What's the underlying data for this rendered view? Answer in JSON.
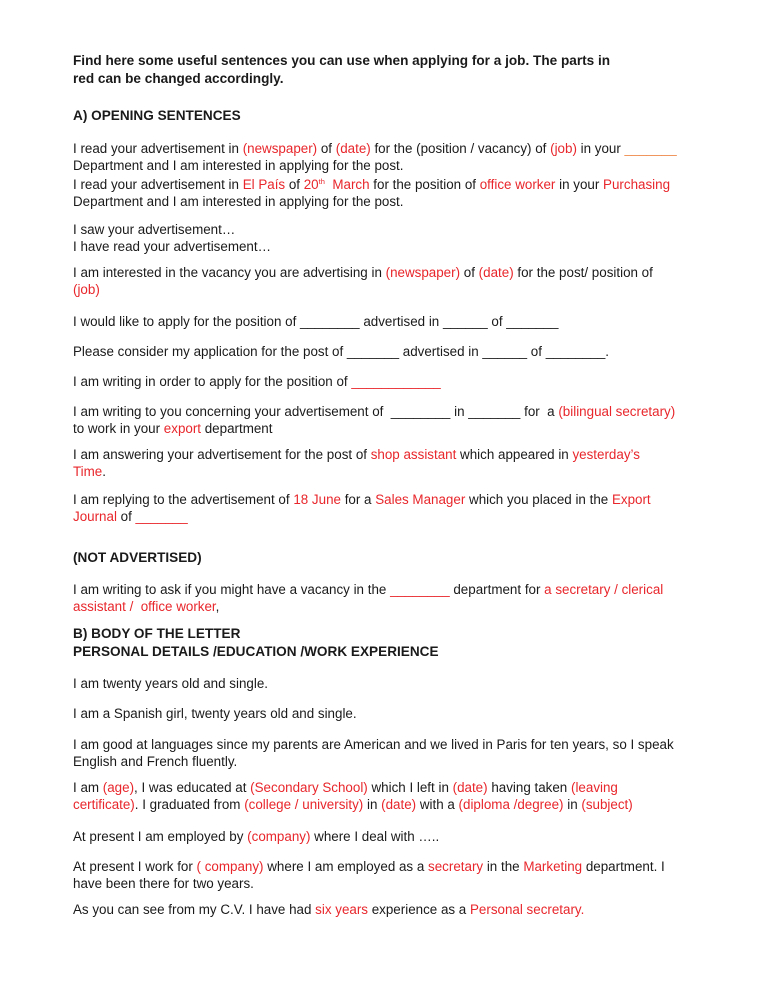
{
  "colors": {
    "text": "#1a1a1a",
    "editable": "#e8262b",
    "blank_orange": "#ef8a4c"
  },
  "intro": {
    "line1": "Find here some useful sentences you can use when applying for a job. The parts in",
    "line2": "red can be changed accordingly."
  },
  "section_a": {
    "heading": "A) OPENING SENTENCES",
    "p1": {
      "a": "I read your advertisement in ",
      "b": "(newspaper)",
      "c": " of ",
      "d": "(date)",
      "e": " for the (position / vacancy) of ",
      "f": "(job)",
      "g": " in your ",
      "h": "_______",
      "line2": "Department and I am interested in applying for the post."
    },
    "p2": {
      "a": "I read your advertisement in ",
      "b": "El País",
      "c": " of ",
      "d": "20",
      "d_sup": "th",
      "e": "  March",
      "f": " for the position of ",
      "g": "office worker",
      "h": " in your ",
      "i": "Purchasing",
      "line2": "Department and I am interested in applying for the post."
    },
    "p3": {
      "line1": "I saw your advertisement…",
      "line2": "I have read your advertisement…"
    },
    "p4": {
      "a": "I am interested in the vacancy you are advertising in ",
      "b": "(newspaper)",
      "c": " of ",
      "d": "(date)",
      "e": " for the post/ position of",
      "line2": "(job)"
    },
    "p5": "I would like to apply for the position of ________ advertised in ______ of _______",
    "p6": "Please consider my application for the post of _______ advertised in ______ of ________.",
    "p7": {
      "a": "I am writing in order to apply for the position of ",
      "b": "____________"
    },
    "p8": {
      "a": "I am writing to you concerning your advertisement of  ________ in _______ for  a ",
      "b": "(bilingual secretary)",
      "line2a": "to work in your ",
      "line2b": "export",
      "line2c": " department"
    },
    "p9": {
      "a": "I am answering your advertisement for the post of ",
      "b": "shop assistant",
      "c": " which appeared in ",
      "d": "yesterday’s",
      "line2a": "Time",
      "line2b": "."
    },
    "p10": {
      "a": "I am replying to the advertisement of ",
      "b": "18 June",
      "c": " for a ",
      "d": "Sales Manager",
      "e": " which you placed in the ",
      "f": "Export",
      "line2a": "Journal",
      "line2b": " of ",
      "line2c": "_______"
    }
  },
  "not_advertised": {
    "heading": "(NOT ADVERTISED)",
    "p1": {
      "a": "I am writing to ask if you might have a vacancy in the ",
      "b": "________",
      "c": " department for ",
      "d": "a secretary / clerical",
      "line2a": "assistant /  office worker",
      "line2b": ","
    }
  },
  "section_b": {
    "heading1": "B) BODY OF THE LETTER",
    "heading2": "PERSONAL DETAILS /EDUCATION /WORK EXPERIENCE",
    "p1": "I am twenty years old and single.",
    "p2": "I am a Spanish girl, twenty years old and single.",
    "p3": {
      "line1": "I am good at languages since my parents are American and we lived in Paris for ten years, so I speak",
      "line2": "English and French fluently."
    },
    "p4": {
      "a": "I am ",
      "b": "(age)",
      "c": ", I was educated at ",
      "d": "(Secondary School)",
      "e": " which I left in ",
      "f": "(date)",
      "g": " having taken ",
      "h": "(leaving",
      "l2a": "certificate)",
      "l2b": ". I graduated from ",
      "l2c": "(college / university)",
      "l2d": " in ",
      "l2e": "(date)",
      "l2f": " with a ",
      "l2g": "(diploma /degree)",
      "l2h": " in ",
      "l2i": "(subject)"
    },
    "p5": {
      "a": "At present I am employed by ",
      "b": "(company)",
      "c": " where I deal with ….."
    },
    "p6": {
      "a": "At present I work for ",
      "b": "( company)",
      "c": " where I am employed as a ",
      "d": "secretary",
      "e": " in the ",
      "f": "Marketing",
      "g": " department. I",
      "line2": "have been there for two years."
    },
    "p7": {
      "a": "As you can see from my C.V. I have had ",
      "b": "six years",
      "c": " experience as a ",
      "d": "Personal secretary."
    }
  }
}
